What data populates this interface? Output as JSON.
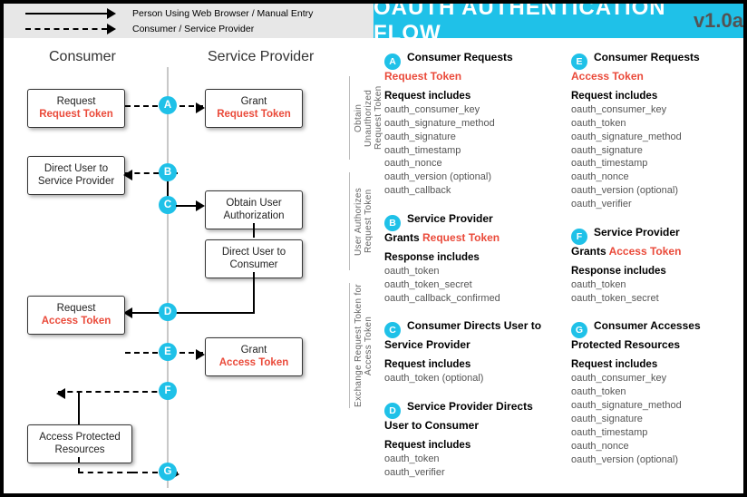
{
  "legend": {
    "solid": "Person Using Web Browser / Manual Entry",
    "dashed": "Consumer / Service Provider"
  },
  "header": {
    "title": "OAUTH AUTHENTICATION FLOW",
    "version": "v1.0a"
  },
  "columns": {
    "consumer": "Consumer",
    "provider": "Service Provider"
  },
  "boxes": {
    "a_consumer_l1": "Request",
    "a_consumer_l2": "Request Token",
    "a_provider_l1": "Grant",
    "a_provider_l2": "Request Token",
    "b_consumer_l1": "Direct User to",
    "b_consumer_l2": "Service Provider",
    "c_provider_l1": "Obtain User",
    "c_provider_l2": "Authorization",
    "c2_provider_l1": "Direct User to",
    "c2_provider_l2": "Consumer",
    "d_consumer_l1": "Request",
    "d_consumer_l2": "Access Token",
    "e_provider_l1": "Grant",
    "e_provider_l2": "Access Token",
    "g_consumer_l1": "Access Protected",
    "g_consumer_l2": "Resources"
  },
  "badges": {
    "a": "A",
    "b": "B",
    "c": "C",
    "d": "D",
    "e": "E",
    "f": "F",
    "g": "G"
  },
  "stages": {
    "s1": "Obtain Unauthorized\nRequest Token",
    "s2": "User Authorizes\nRequest Token",
    "s3": "Exchange Request Token\nfor Access Token"
  },
  "steps": {
    "A": {
      "title_1": "Consumer Requests",
      "title_2": "Request Token",
      "sub": "Request includes",
      "params": [
        "oauth_consumer_key",
        "oauth_signature_method",
        "oauth_signature",
        "oauth_timestamp",
        "oauth_nonce",
        "oauth_version (optional)",
        "oauth_callback"
      ]
    },
    "B": {
      "title_1": "Service Provider",
      "title_2a": "Grants ",
      "title_2b": "Request Token",
      "sub": "Response includes",
      "params": [
        "oauth_token",
        "oauth_token_secret",
        "oauth_callback_confirmed"
      ]
    },
    "C": {
      "title_1": "Consumer Directs User to",
      "title_2": "Service Provider",
      "sub": "Request includes",
      "params": [
        "oauth_token (optional)"
      ]
    },
    "D": {
      "title_1": "Service Provider Directs",
      "title_2": "User to Consumer",
      "sub": "Request includes",
      "params": [
        "oauth_token",
        "oauth_verifier"
      ]
    },
    "E": {
      "title_1": "Consumer Requests",
      "title_2": "Access Token",
      "sub": "Request includes",
      "params": [
        "oauth_consumer_key",
        "oauth_token",
        "oauth_signature_method",
        "oauth_signature",
        "oauth_timestamp",
        "oauth_nonce",
        "oauth_version (optional)",
        "oauth_verifier"
      ]
    },
    "F": {
      "title_1": "Service Provider",
      "title_2a": "Grants ",
      "title_2b": "Access Token",
      "sub": "Response includes",
      "params": [
        "oauth_token",
        "oauth_token_secret"
      ]
    },
    "G": {
      "title_1": "Consumer Accesses",
      "title_2": "Protected Resources",
      "sub": "Request includes",
      "params": [
        "oauth_consumer_key",
        "oauth_token",
        "oauth_signature_method",
        "oauth_signature",
        "oauth_timestamp",
        "oauth_nonce",
        "oauth_version (optional)"
      ]
    }
  }
}
